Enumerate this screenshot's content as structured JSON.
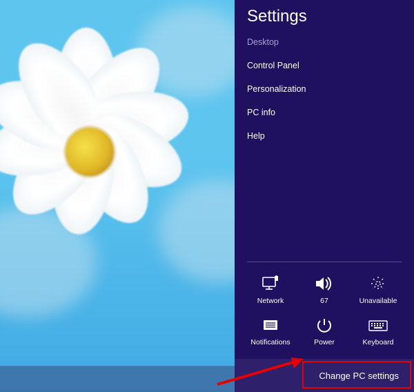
{
  "charm": {
    "title": "Settings",
    "menu": [
      {
        "label": "Desktop",
        "muted": true
      },
      {
        "label": "Control Panel"
      },
      {
        "label": "Personalization"
      },
      {
        "label": "PC info"
      },
      {
        "label": "Help"
      }
    ],
    "tiles": {
      "network": {
        "label": "Network"
      },
      "volume": {
        "label": "67"
      },
      "brightness": {
        "label": "Unavailable"
      },
      "notifications": {
        "label": "Notifications"
      },
      "power": {
        "label": "Power"
      },
      "keyboard": {
        "label": "Keyboard"
      }
    },
    "change_pc_settings": "Change PC settings"
  }
}
